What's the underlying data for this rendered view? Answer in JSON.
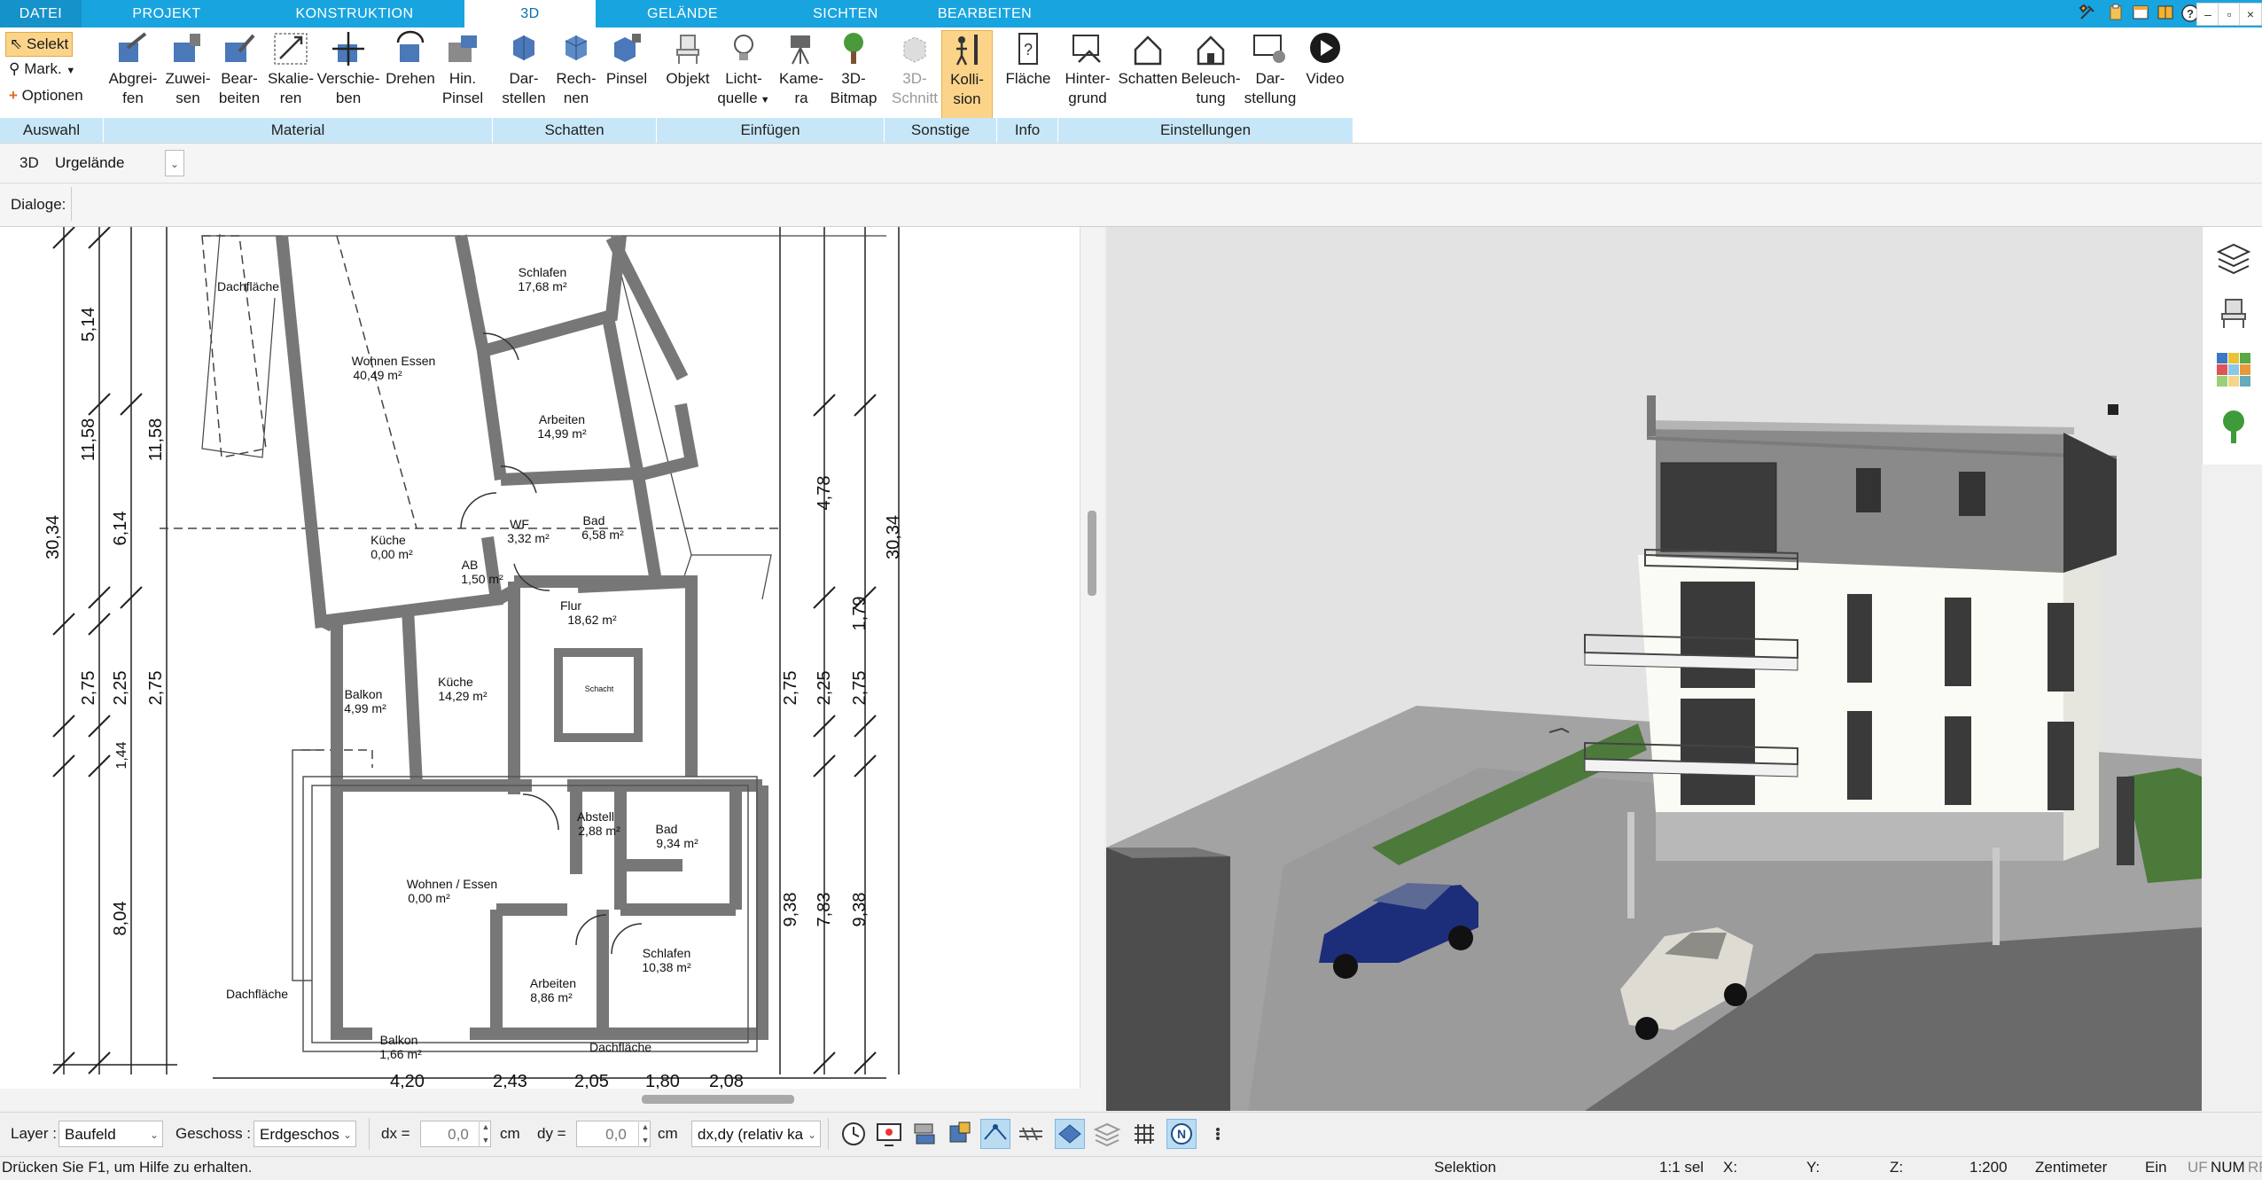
{
  "tabs": [
    {
      "label": "DATEI"
    },
    {
      "label": "PROJEKT"
    },
    {
      "label": "KONSTRUKTION"
    },
    {
      "label": "3D"
    },
    {
      "label": "GELÄNDE"
    },
    {
      "label": "SICHTEN"
    },
    {
      "label": "BEARBEITEN"
    }
  ],
  "selection": {
    "selekt": "Selekt",
    "mark": "Mark.",
    "optionen": "Optionen"
  },
  "ribbon_buttons": {
    "abgreifen": [
      "Abgrei-",
      "fen"
    ],
    "zuweisen": [
      "Zuwei-",
      "sen"
    ],
    "bearbeiten": [
      "Bear-",
      "beiten"
    ],
    "skalieren": [
      "Skalie-",
      "ren"
    ],
    "verschieben": [
      "Verschie-",
      "ben"
    ],
    "drehen": [
      "Drehen",
      ""
    ],
    "hinpinsel": [
      "Hin.",
      "Pinsel"
    ],
    "darstellen": [
      "Dar-",
      "stellen"
    ],
    "rechnen": [
      "Rech-",
      "nen"
    ],
    "pinsel": [
      "Pinsel",
      ""
    ],
    "objekt": [
      "Objekt",
      ""
    ],
    "lichtquelle": [
      "Licht-",
      "quelle"
    ],
    "kamera": [
      "Kame-",
      "ra"
    ],
    "bitmap": [
      "3D-",
      "Bitmap"
    ],
    "schnitt": [
      "3D-",
      "Schnitt"
    ],
    "kollision": [
      "Kolli-",
      "sion"
    ],
    "flaeche": [
      "Fläche",
      ""
    ],
    "hintergrund": [
      "Hinter-",
      "grund"
    ],
    "schatten": [
      "Schatten",
      ""
    ],
    "beleuchtung": [
      "Beleuch-",
      "tung"
    ],
    "darstellung": [
      "Dar-",
      "stellung"
    ],
    "video": [
      "Video",
      ""
    ]
  },
  "groups": {
    "auswahl": "Auswahl",
    "material": "Material",
    "schatten": "Schatten",
    "einfuegen": "Einfügen",
    "sonstige": "Sonstige",
    "info": "Info",
    "einstellungen": "Einstellungen"
  },
  "viewbar": {
    "mode": "3D",
    "terrain": "Urgelände"
  },
  "dialogbar": {
    "label": "Dialoge:"
  },
  "plan": {
    "rooms": [
      {
        "name": "Schlafen",
        "area": "17,68 m²"
      },
      {
        "name": "Wohnen Essen",
        "area": "40,49 m²"
      },
      {
        "name": "Arbeiten",
        "area": "14,99 m²"
      },
      {
        "name": "WF",
        "area": "3,32 m²"
      },
      {
        "name": "Bad",
        "area": "6,58 m²"
      },
      {
        "name": "Küche",
        "area": "0,00 m²"
      },
      {
        "name": "AB",
        "area": "1,50 m²"
      },
      {
        "name": "Flur",
        "area": "18,62 m²"
      },
      {
        "name": "Küche",
        "area": "14,29 m²"
      },
      {
        "name": "Balkon",
        "area": "4,99 m²"
      },
      {
        "name": "Abstell",
        "area": "2,88 m²"
      },
      {
        "name": "Bad",
        "area": "9,34 m²"
      },
      {
        "name": "Wohnen / Essen",
        "area": "0,00 m²"
      },
      {
        "name": "Arbeiten",
        "area": "8,86 m²"
      },
      {
        "name": "Schlafen",
        "area": "10,38 m²"
      },
      {
        "name": "Balkon",
        "area": "1,66 m²"
      }
    ],
    "labels": {
      "dachflaeche1": "Dachfläche",
      "dachflaeche2": "Dachfläche",
      "dachflaeche3": "Dachfläche",
      "schacht": "Schacht"
    },
    "dims_left": {
      "total": "30,34",
      "d1": "5,14",
      "d2": "11,58",
      "d3": "11,58",
      "d4": "6,14",
      "d5": "2,75",
      "d6": "2,25",
      "d7": "2,75",
      "d8": "8,04",
      "d9": "1,44"
    },
    "dims_right": {
      "total": "30,34",
      "d1": "4,78",
      "d2": "1,79",
      "d3": "2,75",
      "d4": "2,25",
      "d5": "2,75",
      "d6": "9,38",
      "d7": "9,38",
      "d8": "7,83"
    },
    "dims_bottom": {
      "b1": "4,20",
      "b2": "2,43",
      "b3": "2,05",
      "b4": "1,80",
      "b5": "2,08"
    }
  },
  "layerbar": {
    "layer_label": "Layer :",
    "layer_value": "Baufeld",
    "geschoss_label": "Geschoss :",
    "geschoss_value": "Erdgeschos",
    "dx_label": "dx =",
    "dx_value": "0,0",
    "dx_unit": "cm",
    "dy_label": "dy =",
    "dy_value": "0,0",
    "dy_unit": "cm",
    "mode_value": "dx,dy (relativ ka"
  },
  "statusbar": {
    "help": "Drücken Sie F1, um Hilfe zu erhalten.",
    "mode": "Selektion",
    "scale_sel": "1:1 sel",
    "x": "X:",
    "y": "Y:",
    "z": "Z:",
    "scale": "1:200",
    "unit": "Zentimeter",
    "ein": "Ein",
    "uf": "UF",
    "num": "NUM",
    "rf": "RF"
  },
  "colors": {
    "accent": "#18a4df",
    "group_bg": "#c7e7f8",
    "active_btn": "#fbd48a"
  }
}
